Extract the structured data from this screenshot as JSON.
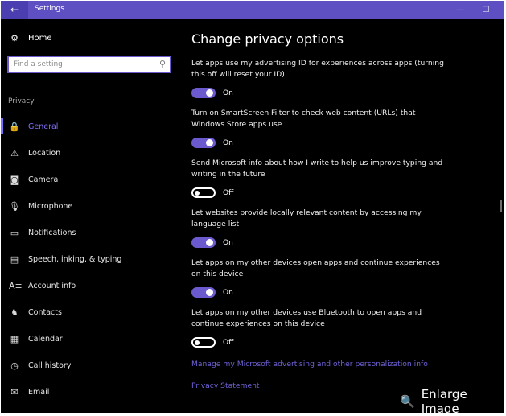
{
  "window": {
    "title": "Settings",
    "back_glyph": "←",
    "minimize_glyph": "—",
    "maximize_glyph": "☐"
  },
  "sidebar": {
    "home": {
      "label": "Home",
      "icon": "gear-icon",
      "glyph": "⚙"
    },
    "search": {
      "placeholder": "Find a setting",
      "icon": "search-icon",
      "glyph": "⚲"
    },
    "section": "Privacy",
    "items": [
      {
        "label": "General",
        "icon": "lock-icon",
        "glyph": "🔒",
        "active": true
      },
      {
        "label": "Location",
        "icon": "location-icon",
        "glyph": "⚠"
      },
      {
        "label": "Camera",
        "icon": "camera-icon",
        "glyph": "◙"
      },
      {
        "label": "Microphone",
        "icon": "microphone-icon",
        "glyph": "🎙"
      },
      {
        "label": "Notifications",
        "icon": "notifications-icon",
        "glyph": "▭"
      },
      {
        "label": "Speech, inking, & typing",
        "icon": "speech-icon",
        "glyph": "▤"
      },
      {
        "label": "Account info",
        "icon": "account-icon",
        "glyph": "A≡"
      },
      {
        "label": "Contacts",
        "icon": "contacts-icon",
        "glyph": "♞"
      },
      {
        "label": "Calendar",
        "icon": "calendar-icon",
        "glyph": "▦"
      },
      {
        "label": "Call history",
        "icon": "call-history-icon",
        "glyph": "◷"
      },
      {
        "label": "Email",
        "icon": "email-icon",
        "glyph": "✉"
      }
    ]
  },
  "main": {
    "title": "Change privacy options",
    "settings": [
      {
        "text": "Let apps use my advertising ID for experiences across apps (turning this off will reset your ID)",
        "on": true,
        "state": "On"
      },
      {
        "text": "Turn on SmartScreen Filter to check web content (URLs) that Windows Store apps use",
        "on": true,
        "state": "On"
      },
      {
        "text": "Send Microsoft info about how I write to help us improve typing and writing in the future",
        "on": false,
        "state": "Off"
      },
      {
        "text": "Let websites provide locally relevant content by accessing my language list",
        "on": true,
        "state": "On"
      },
      {
        "text": "Let apps on my other devices open apps and continue experiences on this device",
        "on": true,
        "state": "On"
      },
      {
        "text": "Let apps on my other devices use Bluetooth to open apps and continue experiences on this device",
        "on": false,
        "state": "Off"
      }
    ],
    "links": [
      "Manage my Microsoft advertising and other personalization info",
      "Privacy Statement"
    ]
  },
  "overlay": {
    "label": "Enlarge Image",
    "icon": "search-icon",
    "glyph": "🔍"
  },
  "colors": {
    "titlebar": "#5e4fc2",
    "accent": "#6a5acd",
    "background": "#000000",
    "link": "#6f62d6"
  }
}
